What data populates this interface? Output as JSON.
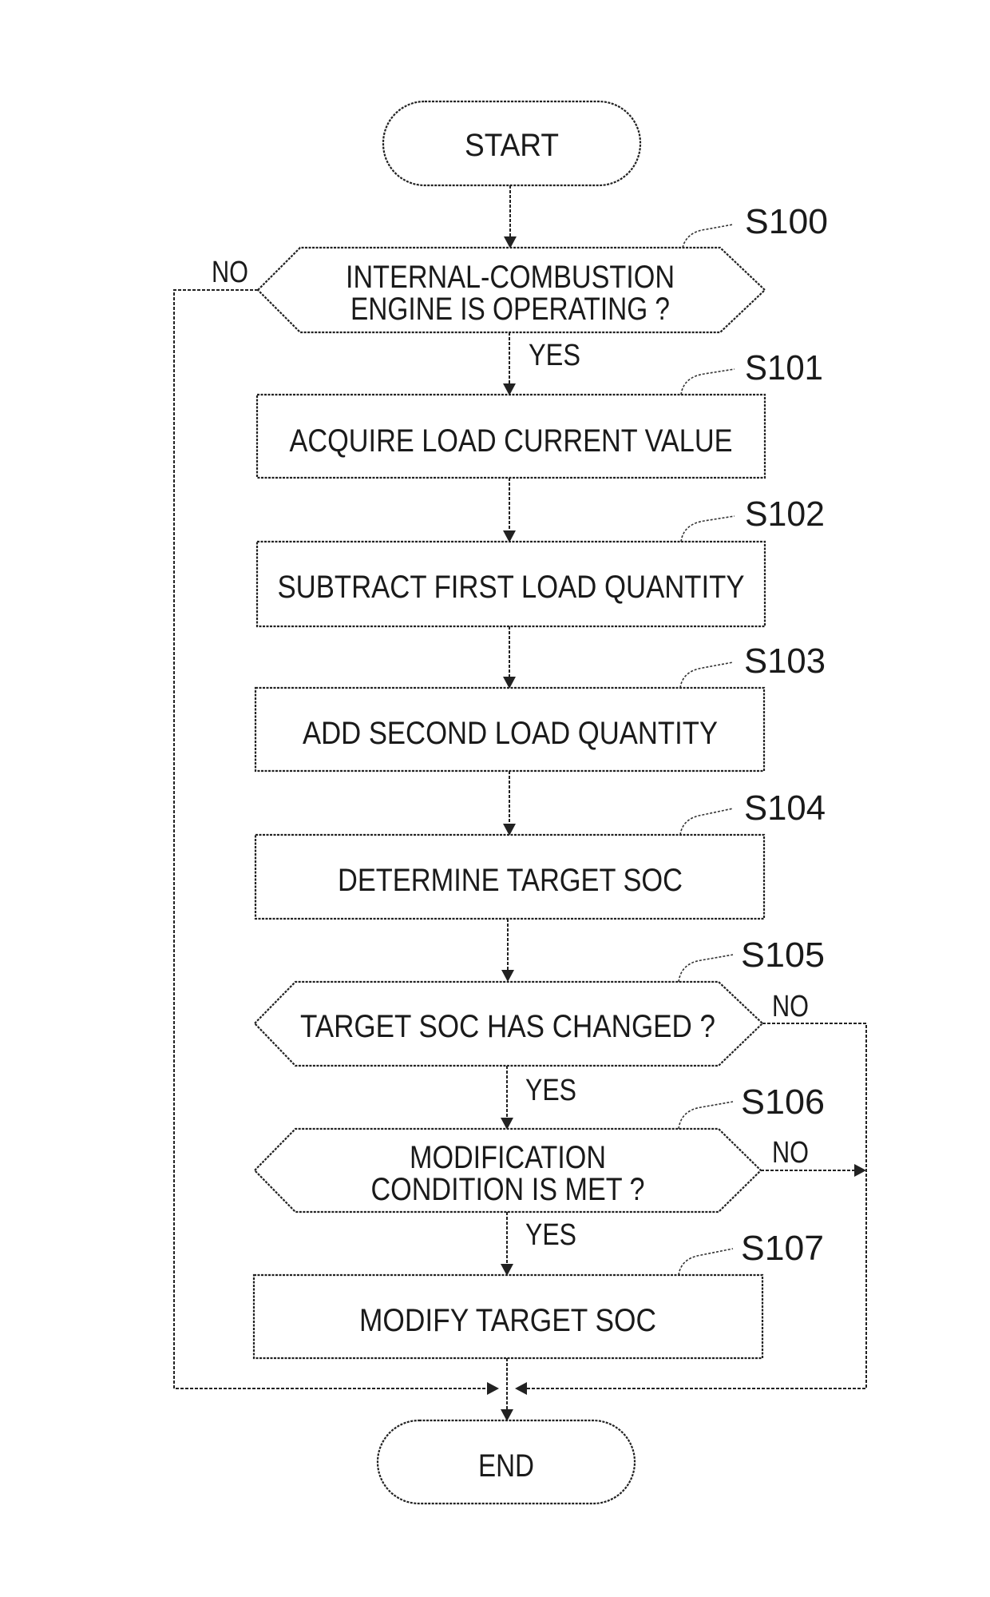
{
  "flowchart": {
    "start_label": "START",
    "end_label": "END",
    "steps": [
      {
        "id": "S100",
        "type": "decision",
        "lines": [
          "INTERNAL-COMBUSTION",
          "ENGINE IS OPERATING ?"
        ],
        "yes_label": "YES",
        "no_label": "NO"
      },
      {
        "id": "S101",
        "type": "process",
        "lines": [
          "ACQUIRE LOAD CURRENT VALUE"
        ]
      },
      {
        "id": "S102",
        "type": "process",
        "lines": [
          "SUBTRACT FIRST LOAD QUANTITY"
        ]
      },
      {
        "id": "S103",
        "type": "process",
        "lines": [
          "ADD SECOND LOAD QUANTITY"
        ]
      },
      {
        "id": "S104",
        "type": "process",
        "lines": [
          "DETERMINE TARGET SOC"
        ]
      },
      {
        "id": "S105",
        "type": "decision",
        "lines": [
          "TARGET SOC HAS CHANGED ?"
        ],
        "yes_label": "YES",
        "no_label": "NO"
      },
      {
        "id": "S106",
        "type": "decision",
        "lines": [
          "MODIFICATION",
          "CONDITION IS MET ?"
        ],
        "yes_label": "YES",
        "no_label": "NO"
      },
      {
        "id": "S107",
        "type": "process",
        "lines": [
          "MODIFY TARGET SOC"
        ]
      }
    ]
  }
}
